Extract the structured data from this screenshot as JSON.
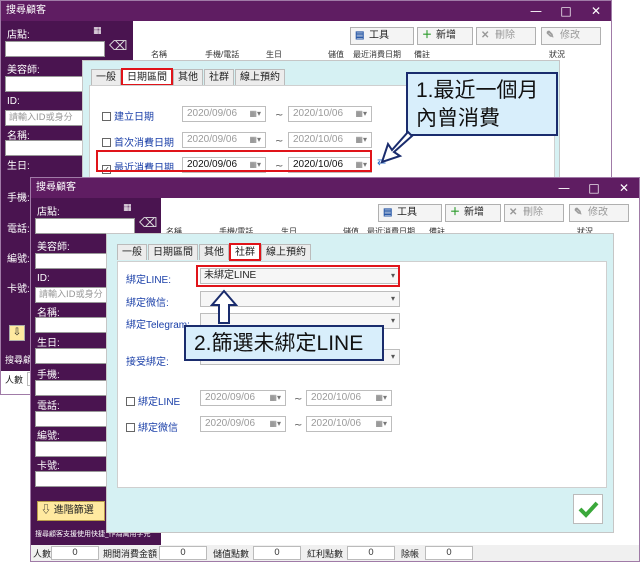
{
  "window_back": {
    "title": "搜尋顧客",
    "controls": [
      "—",
      "□",
      "✕"
    ],
    "fields": {
      "store": "店點:",
      "beautician": "美容師:",
      "id": "ID:",
      "id_placeholder": "請輸入ID或身分",
      "name": "名稱:",
      "birthday": "生日:",
      "phone": "手機:",
      "tel": "電話:",
      "code": "編號:",
      "card": "卡號:"
    },
    "toolbar": {
      "tools": "工具",
      "add": "新增",
      "delete": "刪除",
      "edit": "修改"
    },
    "grid_headers": [
      "名稱",
      "手機/電話",
      "生日",
      "儲值",
      "最近消費日期",
      "備註",
      "狀況"
    ],
    "status_left": "搜尋顧",
    "status_count": "人數"
  },
  "dialog_back": {
    "tabs": [
      "一般",
      "日期區間",
      "其他",
      "社群",
      "線上預約"
    ],
    "active_tab": "日期區間",
    "rows": [
      {
        "label": "建立日期",
        "checked": false,
        "from": "2020/09/06",
        "to": "2020/10/06"
      },
      {
        "label": "首次消費日期",
        "checked": false,
        "from": "2020/09/06",
        "to": "2020/10/06"
      },
      {
        "label": "最近消費日期",
        "checked": true,
        "from": "2020/09/06",
        "to": "2020/10/06"
      }
    ],
    "tilde": "~"
  },
  "callout_1": {
    "line1": "1.最近一個月",
    "line2": "內曾消費"
  },
  "window_front": {
    "title": "搜尋顧客",
    "controls": [
      "—",
      "□",
      "✕"
    ],
    "fields": {
      "store": "店點:",
      "beautician": "美容師:",
      "id": "ID:",
      "id_placeholder": "請輸入ID或身分",
      "name": "名稱:",
      "birthday": "生日:",
      "phone": "手機:",
      "tel": "電話:",
      "code": "編號:",
      "card": "卡號:"
    },
    "toolbar": {
      "tools": "工具",
      "add": "新增",
      "delete": "刪除",
      "edit": "修改"
    },
    "grid_headers": [
      "名稱",
      "手機/電話",
      "生日",
      "儲值",
      "最近消費日期",
      "備註",
      "狀況"
    ],
    "advanced_filter": "進階篩選",
    "footer_note": "搜尋顧客支援使用快捷_作為萬用字元",
    "status": [
      {
        "label": "人數",
        "value": "0"
      },
      {
        "label": "期間消費金額",
        "value": "0"
      },
      {
        "label": "儲值點數",
        "value": "0"
      },
      {
        "label": "紅利點數",
        "value": "0"
      },
      {
        "label": "除帳",
        "value": "0"
      }
    ]
  },
  "dialog_front": {
    "tabs": [
      "一般",
      "日期區間",
      "其他",
      "社群",
      "線上預約"
    ],
    "active_tab": "社群",
    "line_label": "綁定LINE:",
    "line_value": "未綁定LINE",
    "wechat_label": "綁定微信:",
    "telegram_label": "綁定Telegram:",
    "accept_label": "接受綁定:",
    "date_rows": [
      {
        "label": "綁定LINE",
        "from": "2020/09/06",
        "to": "2020/10/06"
      },
      {
        "label": "綁定微信",
        "from": "2020/09/06",
        "to": "2020/10/06"
      }
    ],
    "tilde": "~"
  },
  "callout_2": {
    "text": "2.篩選未綁定LINE"
  },
  "colors": {
    "title_bar": "#5f1d62",
    "sidebar": "#4a1450",
    "dialog_bg": "#d6f1f3",
    "highlight": "#e0141a",
    "callout_bg": "#d8eefb"
  }
}
